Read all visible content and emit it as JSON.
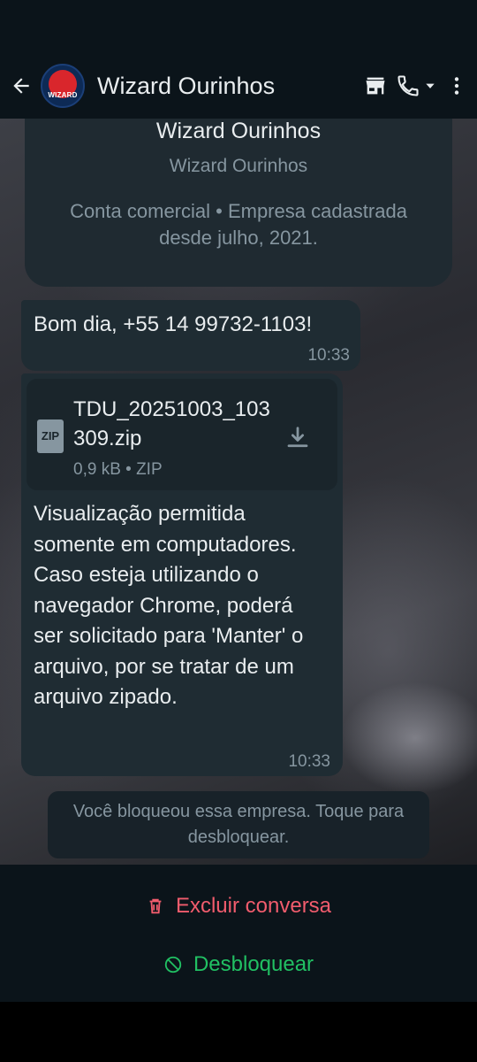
{
  "header": {
    "title": "Wizard Ourinhos",
    "avatar_text": "WIZARD",
    "icons": [
      "back-arrow-icon",
      "store-icon",
      "phone-icon",
      "dropdown-caret-icon",
      "more-vert-icon"
    ]
  },
  "business_card": {
    "name": "Wizard Ourinhos",
    "subtitle": "Wizard Ourinhos",
    "info": "Conta comercial • Empresa cadastrada desde julho, 2021."
  },
  "messages": [
    {
      "text": "Bom dia, +55 14 99732-1103!",
      "time": "10:33"
    },
    {
      "file": {
        "name": "TDU_20251003_103309.zip",
        "icon_label": "ZIP",
        "meta": "0,9 kB • ZIP"
      },
      "text": "Visualização permitida somente em computadores. Caso esteja utilizando o navegador Chrome, poderá ser solicitado para 'Manter' o arquivo, por se tratar de um arquivo zipado.",
      "time": "10:33"
    }
  ],
  "system_notice": "Você bloqueou essa empresa. Toque para desbloquear.",
  "actions": {
    "delete_label": "Excluir conversa",
    "unblock_label": "Desbloquear"
  },
  "colors": {
    "bar_bg": "#0b141a",
    "bubble_bg": "#1f2c33",
    "danger": "#f15c6d",
    "success": "#21c063"
  }
}
